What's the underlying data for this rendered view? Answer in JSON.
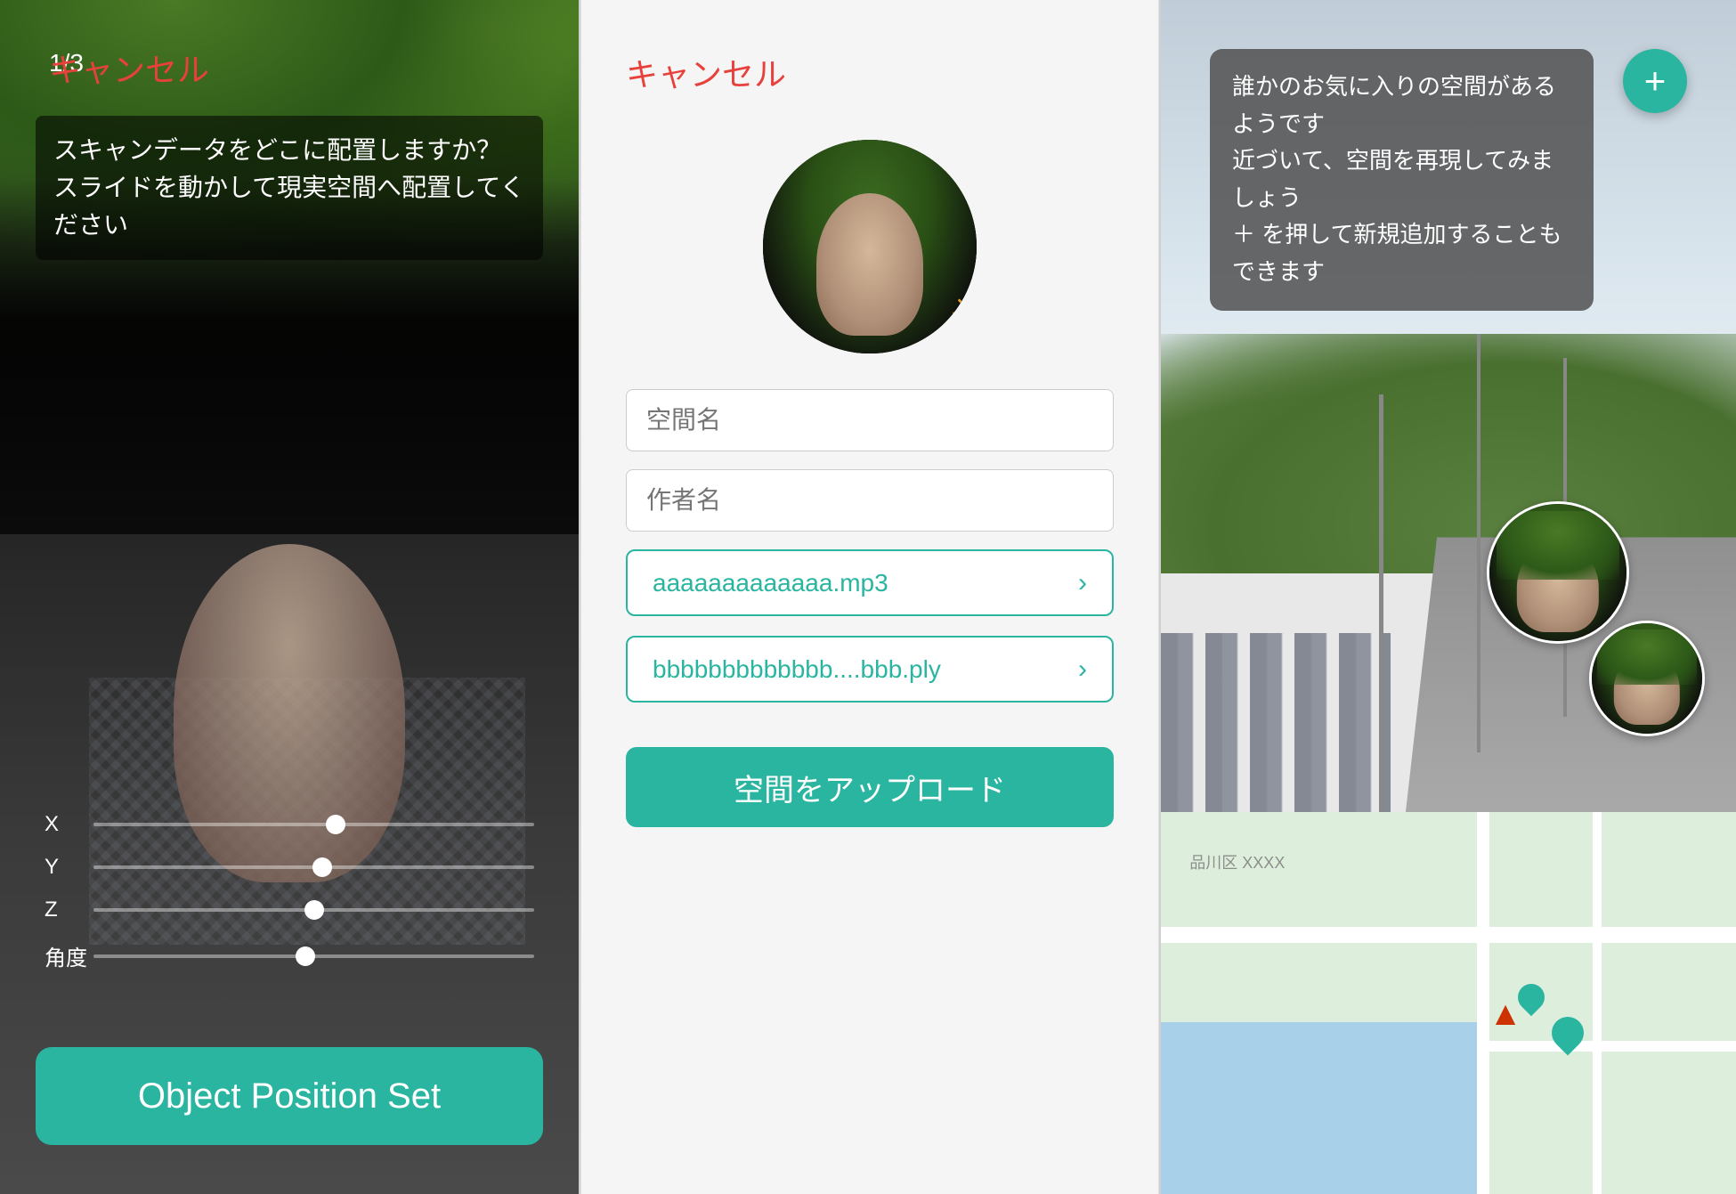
{
  "panel1": {
    "badge": "1/3",
    "cancel_label": "キャンセル",
    "instruction": "スキャンデータをどこに配置しますか？\nスライドを動かして現実空間へ配置してください",
    "sliders": [
      {
        "label": "X",
        "position": 0.55
      },
      {
        "label": "Y",
        "position": 0.52
      },
      {
        "label": "Z",
        "position": 0.5
      },
      {
        "label": "角度",
        "position": 0.48
      }
    ],
    "btn_label": "Object Position Set"
  },
  "panel2": {
    "cancel_label": "キャンセル",
    "input1_placeholder": "空間名",
    "input2_placeholder": "作者名",
    "file1_label": "aaaaaaaaaaaaa.mp3",
    "file2_label": "bbbbbbbbbbbbb....bbb.ply",
    "upload_label": "空間をアップロード",
    "sun_icon": "☀"
  },
  "panel3": {
    "fab_icon": "+",
    "bubble_text": "誰かのお気に入りの空間があるようです\n近づいて、空間を再現してみましょう\n＋ を押して新規追加することもできます"
  }
}
